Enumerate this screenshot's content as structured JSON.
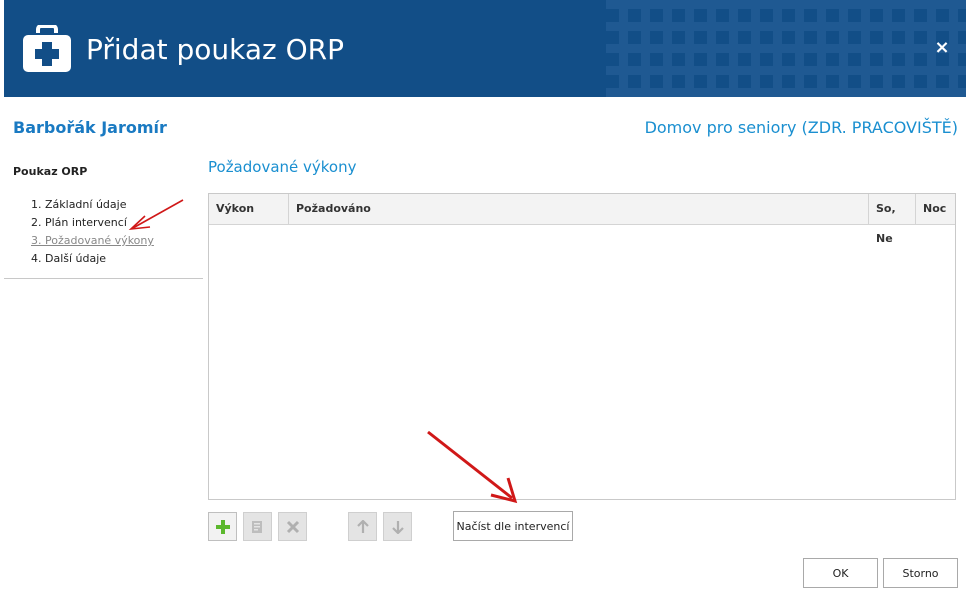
{
  "dialog": {
    "title": "Přidat poukaz ORP",
    "close_label": "×"
  },
  "patient": {
    "name": "Barbořák Jaromír",
    "facility": "Domov pro seniory (ZDR. PRACOVIŠTĚ)"
  },
  "sidebar": {
    "title": "Poukaz ORP",
    "steps": [
      {
        "label": "1. Základní údaje"
      },
      {
        "label": "2. Plán intervencí"
      },
      {
        "label": "3. Požadované výkony"
      },
      {
        "label": "4. Další údaje"
      }
    ],
    "active_step": 3
  },
  "main": {
    "section_title": "Požadované výkony",
    "table": {
      "columns": [
        "Výkon",
        "Požadováno",
        "So, Ne",
        "Noc"
      ],
      "rows": []
    },
    "toolbar": {
      "load_button": "Načíst dle intervencí"
    }
  },
  "footer": {
    "ok": "OK",
    "cancel": "Storno"
  },
  "colors": {
    "header_bg": "#124e87",
    "accent": "#1a8fd0",
    "add_icon": "#5cb82d",
    "annotation": "#d01818"
  }
}
